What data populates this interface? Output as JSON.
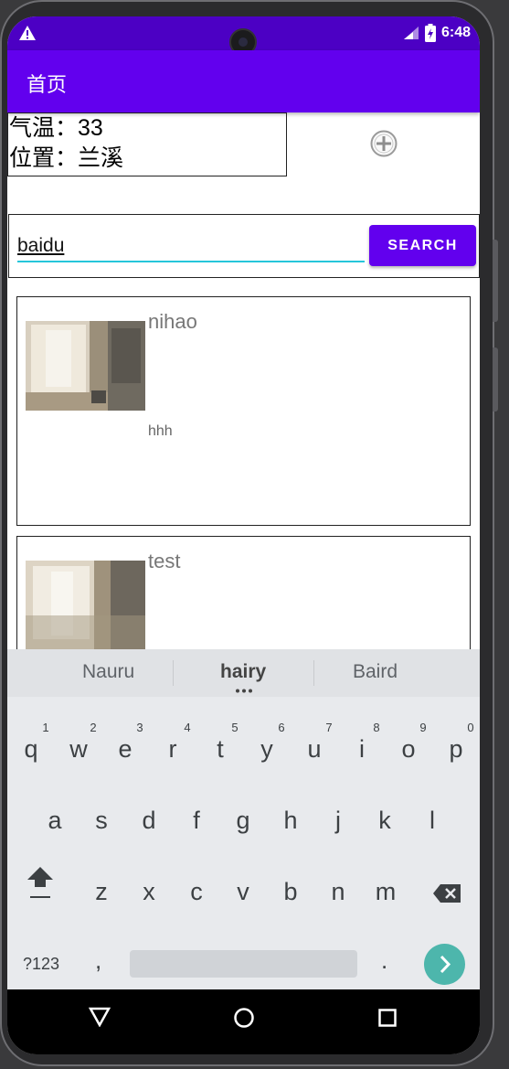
{
  "status_bar": {
    "time": "6:48"
  },
  "app_bar": {
    "title": "首页"
  },
  "weather": {
    "temp_label": "气温：33",
    "location_label": "位置：兰溪"
  },
  "search": {
    "value": "baidu",
    "button_label": "SEARCH"
  },
  "cards": [
    {
      "title": "nihao",
      "desc": "hhh"
    },
    {
      "title": "test"
    }
  ],
  "keyboard": {
    "suggestions": [
      "Nauru",
      "hairy",
      "Baird"
    ],
    "row1": [
      "q",
      "w",
      "e",
      "r",
      "t",
      "y",
      "u",
      "i",
      "o",
      "p"
    ],
    "row1_hints": [
      "1",
      "2",
      "3",
      "4",
      "5",
      "6",
      "7",
      "8",
      "9",
      "0"
    ],
    "row2": [
      "a",
      "s",
      "d",
      "f",
      "g",
      "h",
      "j",
      "k",
      "l"
    ],
    "row3": [
      "z",
      "x",
      "c",
      "v",
      "b",
      "n",
      "m"
    ],
    "symbols_label": "?123",
    "comma": ",",
    "period": ".",
    "accent_color": "#4db6ac"
  },
  "icons": {
    "status": [
      "warning-icon",
      "signal-icon",
      "battery-icon"
    ],
    "add": "add-circle-icon",
    "keyboard": [
      "shift-icon",
      "backspace-icon",
      "enter-arrow-icon"
    ],
    "nav": [
      "back-icon",
      "home-icon",
      "recents-icon"
    ]
  },
  "colors": {
    "primary": "#6200ee",
    "status_bar": "#4c00c4",
    "underline": "#26c6da"
  }
}
